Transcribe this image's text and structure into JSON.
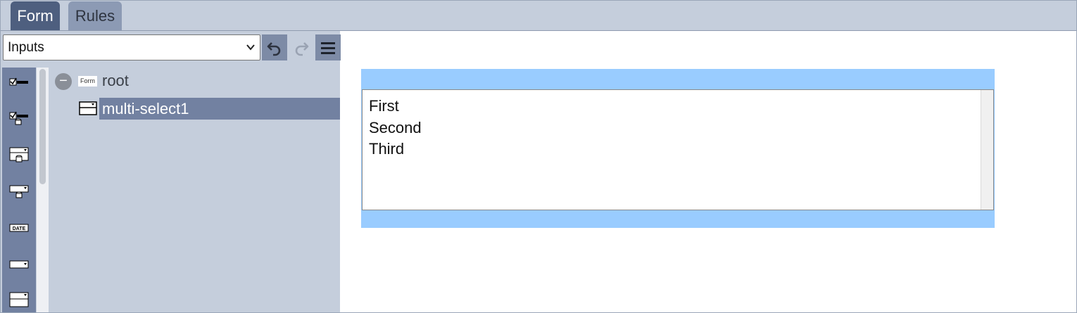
{
  "tabs": [
    {
      "label": "Form",
      "active": true
    },
    {
      "label": "Rules",
      "active": false
    }
  ],
  "toolbar": {
    "select_value": "Inputs",
    "undo_icon": "undo-icon",
    "redo_icon": "redo-icon",
    "menu_icon": "hamburger-menu-icon"
  },
  "palette": {
    "items": [
      "checkbox-icon",
      "checkbox-list-icon",
      "select-data-icon",
      "dropdown-data-icon",
      "date-icon",
      "dropdown-icon",
      "multi-select-icon"
    ],
    "date_text": "DATE"
  },
  "tree": {
    "root": {
      "label": "root",
      "badge": "Form"
    },
    "children": [
      {
        "label": "multi-select1",
        "selected": true
      }
    ]
  },
  "canvas": {
    "options": [
      "First",
      "Second",
      "Third"
    ]
  },
  "colors": {
    "tabbar": "#c5cedc",
    "active_tab": "#4e5f7f",
    "palette": "#7281a1",
    "canvas_bg": "#99ccff"
  }
}
